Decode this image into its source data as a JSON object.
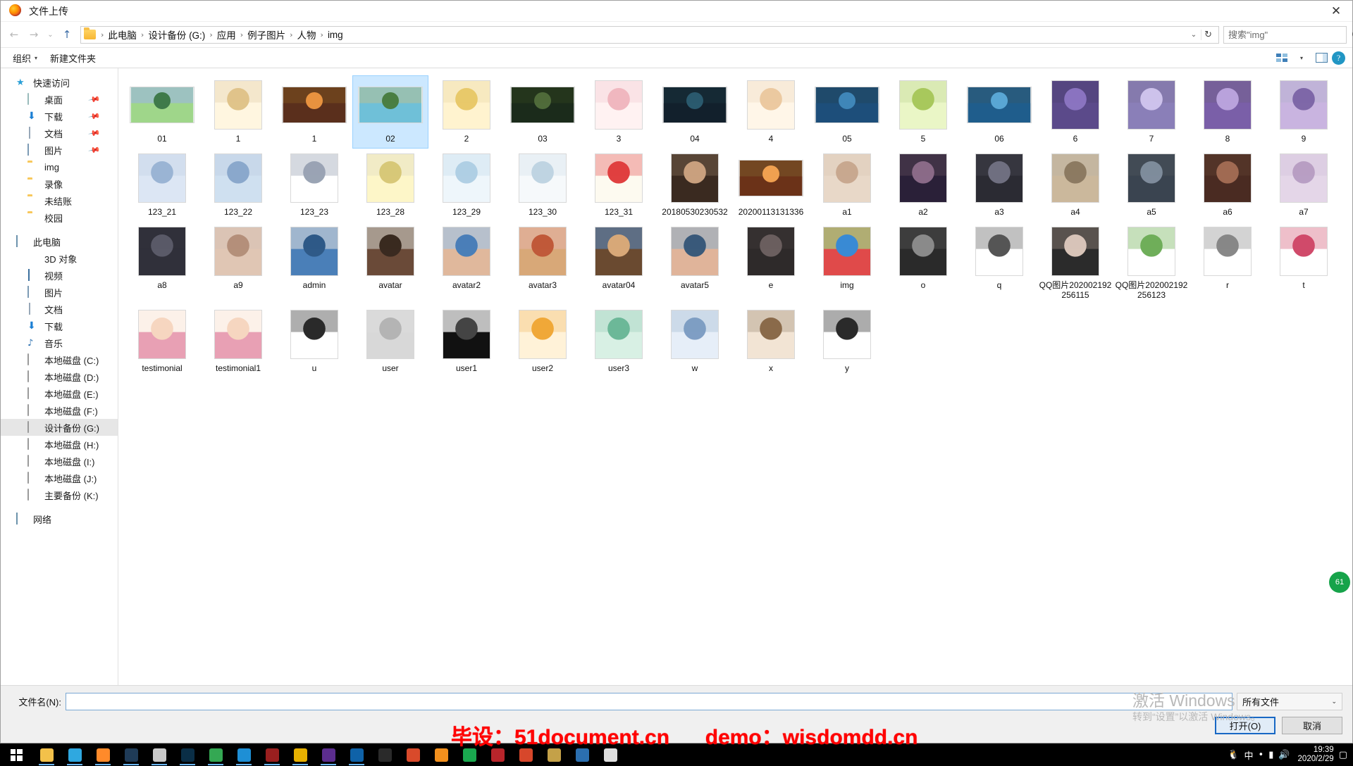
{
  "window": {
    "title": "文件上传",
    "app_icon": "firefox-icon",
    "close_label": "✕"
  },
  "nav": {
    "back": "←",
    "forward": "→",
    "recent": "⌄",
    "up": "↑",
    "breadcrumbs": [
      "此电脑",
      "设计备份 (G:)",
      "应用",
      "例子图片",
      "人物",
      "img"
    ],
    "separator": "›",
    "address_chevron": "⌄",
    "refresh": "↻"
  },
  "search": {
    "placeholder": "搜索\"img\"",
    "value": "",
    "icon": "search-icon"
  },
  "command_bar": {
    "organize": "组织",
    "organize_caret": "▾",
    "new_folder": "新建文件夹",
    "view_caret": "▾",
    "help": "?"
  },
  "sidebar": {
    "groups": [
      {
        "header": {
          "label": "快速访问",
          "icon": "star-icon"
        },
        "items": [
          {
            "label": "桌面",
            "icon": "desktop-icon",
            "pinned": true
          },
          {
            "label": "下载",
            "icon": "download-icon",
            "pinned": true
          },
          {
            "label": "文档",
            "icon": "document-icon",
            "pinned": true
          },
          {
            "label": "图片",
            "icon": "pictures-icon",
            "pinned": true
          },
          {
            "label": "img",
            "icon": "folder-icon",
            "pinned": false
          },
          {
            "label": "录像",
            "icon": "folder-icon",
            "pinned": false
          },
          {
            "label": "未结账",
            "icon": "folder-icon",
            "pinned": false
          },
          {
            "label": "校园",
            "icon": "folder-icon",
            "pinned": false
          }
        ]
      },
      {
        "header": {
          "label": "此电脑",
          "icon": "pc-icon"
        },
        "items": [
          {
            "label": "3D 对象",
            "icon": "3d-objects-icon"
          },
          {
            "label": "视频",
            "icon": "videos-icon"
          },
          {
            "label": "图片",
            "icon": "pictures-icon"
          },
          {
            "label": "文档",
            "icon": "document-icon"
          },
          {
            "label": "下载",
            "icon": "download-icon"
          },
          {
            "label": "音乐",
            "icon": "music-icon"
          },
          {
            "label": "本地磁盘 (C:)",
            "icon": "system-drive-icon"
          },
          {
            "label": "本地磁盘 (D:)",
            "icon": "drive-icon"
          },
          {
            "label": "本地磁盘 (E:)",
            "icon": "drive-icon"
          },
          {
            "label": "本地磁盘 (F:)",
            "icon": "drive-icon"
          },
          {
            "label": "设计备份 (G:)",
            "icon": "drive-icon",
            "selected": true
          },
          {
            "label": "本地磁盘 (H:)",
            "icon": "drive-icon"
          },
          {
            "label": "本地磁盘 (I:)",
            "icon": "drive-icon"
          },
          {
            "label": "本地磁盘 (J:)",
            "icon": "drive-icon"
          },
          {
            "label": "主要备份 (K:)",
            "icon": "drive-icon"
          }
        ]
      },
      {
        "header": {
          "label": "网络",
          "icon": "network-icon"
        },
        "items": []
      }
    ]
  },
  "files": [
    {
      "name": "01",
      "kind": "landscape-green",
      "selected": false
    },
    {
      "name": "1",
      "kind": "cartoon-tea",
      "selected": false
    },
    {
      "name": "1",
      "kind": "photo-sunset",
      "selected": false
    },
    {
      "name": "02",
      "kind": "landscape-lagoon",
      "selected": true
    },
    {
      "name": "2",
      "kind": "cartoon-shout",
      "selected": false
    },
    {
      "name": "03",
      "kind": "landscape-dark",
      "selected": false
    },
    {
      "name": "3",
      "kind": "cartoon-music",
      "selected": false
    },
    {
      "name": "04",
      "kind": "landscape-lake",
      "selected": false
    },
    {
      "name": "4",
      "kind": "cartoon-sleep",
      "selected": false
    },
    {
      "name": "05",
      "kind": "landscape-blue",
      "selected": false
    },
    {
      "name": "5",
      "kind": "cartoon-drink",
      "selected": false
    },
    {
      "name": "06",
      "kind": "landscape-sea",
      "selected": false
    },
    {
      "name": "6",
      "kind": "cartoon-purple",
      "selected": false
    },
    {
      "name": "7",
      "kind": "cartoon-sketch",
      "selected": false
    },
    {
      "name": "8",
      "kind": "cartoon-laugh",
      "selected": false
    },
    {
      "name": "9",
      "kind": "anime-girl",
      "selected": false
    },
    {
      "name": "123_21",
      "kind": "cartoon-cry",
      "selected": false
    },
    {
      "name": "123_22",
      "kind": "cartoon-blue",
      "selected": false
    },
    {
      "name": "123_23",
      "kind": "cartoon-line",
      "selected": false
    },
    {
      "name": "123_28",
      "kind": "cartoon-board",
      "selected": false
    },
    {
      "name": "123_29",
      "kind": "cartoon-drop",
      "selected": false
    },
    {
      "name": "123_30",
      "kind": "cartoon-lay",
      "selected": false
    },
    {
      "name": "123_31",
      "kind": "cartoon-dead",
      "selected": false
    },
    {
      "name": "20180530230532",
      "kind": "photo-boy",
      "selected": false
    },
    {
      "name": "20200113131336",
      "kind": "photo-sunset2",
      "selected": false
    },
    {
      "name": "a1",
      "kind": "photo-woman1",
      "selected": false
    },
    {
      "name": "a2",
      "kind": "photo-woman2",
      "selected": false
    },
    {
      "name": "a3",
      "kind": "photo-woman3",
      "selected": false
    },
    {
      "name": "a4",
      "kind": "photo-couple",
      "selected": false
    },
    {
      "name": "a5",
      "kind": "photo-woman5",
      "selected": false
    },
    {
      "name": "a6",
      "kind": "photo-woman6",
      "selected": false
    },
    {
      "name": "a7",
      "kind": "photo-soft",
      "selected": false
    },
    {
      "name": "a8",
      "kind": "photo-dark",
      "selected": false
    },
    {
      "name": "a9",
      "kind": "photo-woman9",
      "selected": false
    },
    {
      "name": "admin",
      "kind": "avatar-suit",
      "selected": false
    },
    {
      "name": "avatar",
      "kind": "avatar-glasses",
      "selected": false
    },
    {
      "name": "avatar2",
      "kind": "avatar-man",
      "selected": false
    },
    {
      "name": "avatar3",
      "kind": "avatar-woman",
      "selected": false
    },
    {
      "name": "avatar04",
      "kind": "avatar-beard",
      "selected": false
    },
    {
      "name": "avatar5",
      "kind": "avatar-suit2",
      "selected": false
    },
    {
      "name": "e",
      "kind": "anime-boy",
      "selected": false
    },
    {
      "name": "img",
      "kind": "colored-books",
      "selected": false
    },
    {
      "name": "o",
      "kind": "photo-bw",
      "selected": false
    },
    {
      "name": "q",
      "kind": "sketch-cat",
      "selected": false
    },
    {
      "name": "QQ图片202002192256115",
      "kind": "photo-anime-girl",
      "selected": false
    },
    {
      "name": "QQ图片202002192256123",
      "kind": "cartoon-green",
      "selected": false
    },
    {
      "name": "r",
      "kind": "sketch-plain",
      "selected": false
    },
    {
      "name": "t",
      "kind": "sketch-heart",
      "selected": false
    },
    {
      "name": "testimonial",
      "kind": "photo-hat1",
      "selected": false
    },
    {
      "name": "testimonial1",
      "kind": "photo-hat2",
      "selected": false
    },
    {
      "name": "u",
      "kind": "sketch-panda",
      "selected": false
    },
    {
      "name": "user",
      "kind": "avatar-gray",
      "selected": false
    },
    {
      "name": "user1",
      "kind": "avatar-black",
      "selected": false
    },
    {
      "name": "user2",
      "kind": "cartoon-tiger",
      "selected": false
    },
    {
      "name": "user3",
      "kind": "anime-green",
      "selected": false
    },
    {
      "name": "w",
      "kind": "anime-white",
      "selected": false
    },
    {
      "name": "x",
      "kind": "anime-brown",
      "selected": false
    },
    {
      "name": "y",
      "kind": "cartoon-dog",
      "selected": false
    }
  ],
  "bottom": {
    "filename_label": "文件名(N):",
    "filename_value": "",
    "shortcut_hint": "转到\"设置\"以激活 Windows。",
    "filetype_value": "所有文件",
    "filetype_caret": "⌄",
    "open_button": "打开(O)",
    "cancel_button": "取消"
  },
  "watermark": {
    "line1": "激活 Windows",
    "line2": "转到“设置”以激活 Windows。"
  },
  "promo": {
    "left": "毕设：51document.cn",
    "right": "demo：wisdomdd.cn",
    "color": "#ff0000"
  },
  "taskbar": {
    "start": "start-icon",
    "apps": [
      {
        "name": "file-explorer",
        "color": "#f3c14a"
      },
      {
        "name": "edge-browser",
        "color": "#2fa8e0"
      },
      {
        "name": "firefox-browser",
        "color": "#ff8a2a"
      },
      {
        "name": "design-app",
        "color": "#1f3b57"
      },
      {
        "name": "scissors-app",
        "color": "#c9c9c9"
      },
      {
        "name": "photoshop-app",
        "color": "#0a2e46"
      },
      {
        "name": "chrome-browser",
        "color": "#34a853"
      },
      {
        "name": "edge-dev",
        "color": "#1e8fd5"
      },
      {
        "name": "media-player",
        "color": "#9a1f1f"
      },
      {
        "name": "notes-app",
        "color": "#e6b000"
      },
      {
        "name": "visual-studio",
        "color": "#5b2d8e"
      },
      {
        "name": "code-editor",
        "color": "#0f62a8"
      },
      {
        "name": "terminal-app",
        "color": "#2a2a2a"
      },
      {
        "name": "tools-app",
        "color": "#d94a2b"
      },
      {
        "name": "browser-2",
        "color": "#f3901d"
      },
      {
        "name": "chat-app",
        "color": "#1aa84f"
      },
      {
        "name": "pdf-app",
        "color": "#b8252b"
      },
      {
        "name": "office-app",
        "color": "#d7472b"
      },
      {
        "name": "explorer-2",
        "color": "#c4a148"
      },
      {
        "name": "paint-app",
        "color": "#2b6fb0"
      },
      {
        "name": "doc-app",
        "color": "#dedede"
      }
    ],
    "tray": {
      "qq_icon": "qq-penguin-icon",
      "ime": "中",
      "extra": "•",
      "network": "network-icon",
      "volume": "volume-icon",
      "time": "19:39",
      "date": "2020/2/29",
      "notify": "notification-icon"
    }
  },
  "floating_badge": {
    "label": "61"
  }
}
